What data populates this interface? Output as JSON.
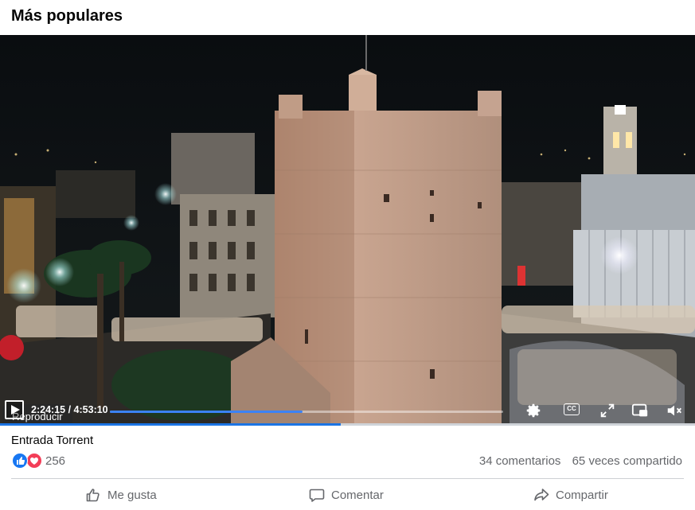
{
  "section": {
    "title": "Más populares"
  },
  "player": {
    "tooltip": "Reproducir",
    "current_time": "2:24:15",
    "separator": "/",
    "duration": "4:53:10",
    "progress_fraction": 0.49,
    "icons": [
      "play-icon",
      "settings-icon",
      "captions-icon",
      "fullscreen-icon",
      "miniplayer-icon",
      "volume-muted-icon"
    ],
    "captions_label": "CC"
  },
  "post": {
    "title": "Entrada Torrent",
    "reaction_count": "256",
    "comments": "34 comentarios",
    "shares": "65 veces compartido"
  },
  "actions": {
    "like": "Me gusta",
    "comment": "Comentar",
    "share": "Compartir"
  },
  "colors": {
    "accent": "#1b74e4",
    "like_blue": "#1877f2",
    "love_red": "#f33e58"
  }
}
